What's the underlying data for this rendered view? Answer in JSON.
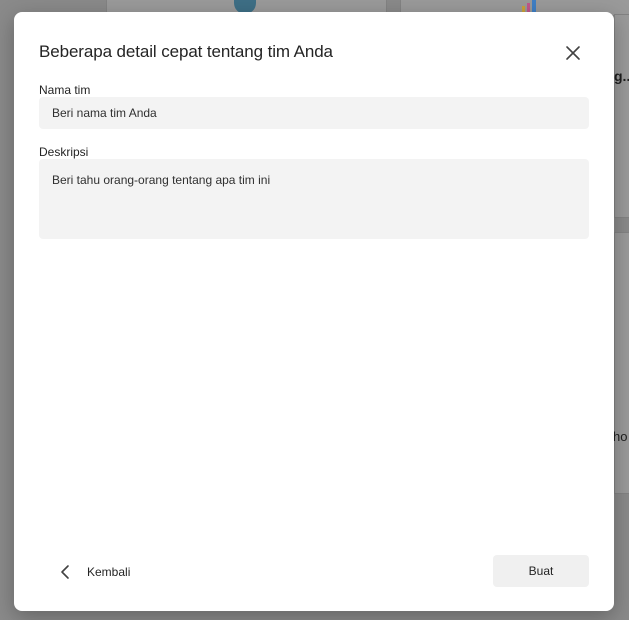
{
  "background": {
    "fragment_1": "g..",
    "fragment_2": "ho"
  },
  "dialog": {
    "title": "Beberapa detail cepat tentang tim Anda",
    "team_name": {
      "label": "Nama tim",
      "placeholder": "Beri nama tim Anda",
      "value": ""
    },
    "description": {
      "label": "Deskripsi",
      "placeholder": "Beri tahu orang-orang tentang apa tim ini",
      "value": ""
    },
    "back_label": "Kembali",
    "create_label": "Buat"
  },
  "colors": {
    "overlay": "#8a8a8a",
    "dialog_bg": "#ffffff",
    "input_bg": "#f3f3f3",
    "button_bg": "#f0f0f0",
    "text": "#242424"
  },
  "icons": {
    "close": "close-icon",
    "back": "chevron-left-icon"
  }
}
